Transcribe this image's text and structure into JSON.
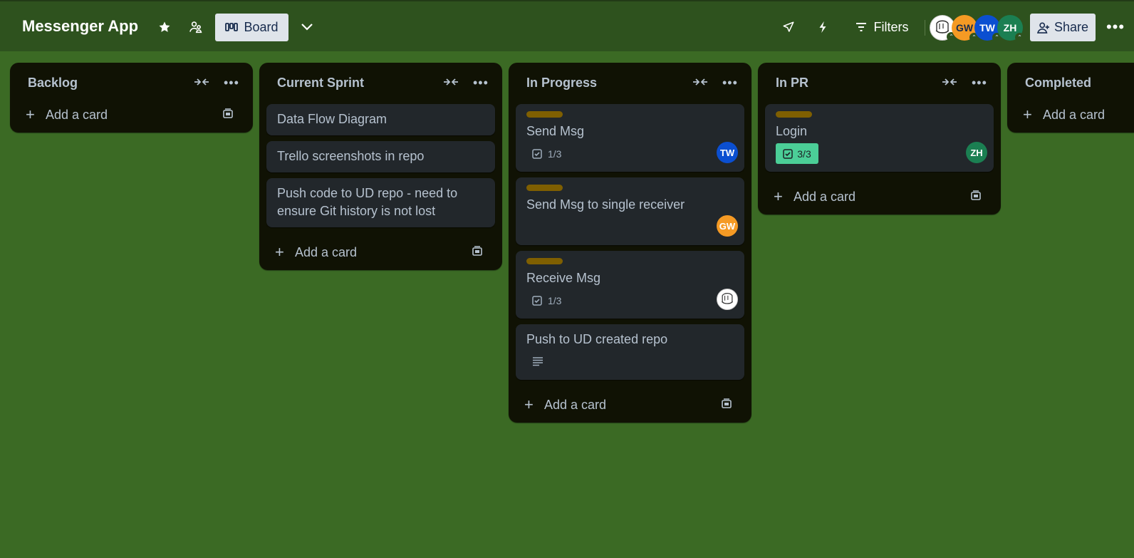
{
  "header": {
    "board_title": "Messenger App",
    "view_label": "Board",
    "filters_label": "Filters",
    "share_label": "Share",
    "members": [
      {
        "initials": "",
        "color": "#ffffff",
        "type": "sketch-avatar"
      },
      {
        "initials": "GW",
        "color": "#f59a24"
      },
      {
        "initials": "TW",
        "color": "#0b4fd1"
      },
      {
        "initials": "ZH",
        "color": "#1b7f52"
      }
    ]
  },
  "lists": [
    {
      "title": "Backlog",
      "add_label": "Add a card",
      "cards": []
    },
    {
      "title": "Current Sprint",
      "add_label": "Add a card",
      "cards": [
        {
          "title": "Data Flow Diagram"
        },
        {
          "title": "Trello screenshots in repo"
        },
        {
          "title": "Push code to UD repo - need to ensure Git history is not lost"
        }
      ]
    },
    {
      "title": "In Progress",
      "add_label": "Add a card",
      "cards": [
        {
          "title": "Send Msg",
          "checklist": "1/3",
          "member": "TW",
          "member_color": "#0b4fd1"
        },
        {
          "title": "Send Msg to single receiver",
          "member": "GW",
          "member_color": "#f59a24"
        },
        {
          "title": "Receive Msg",
          "checklist": "1/3",
          "member": "",
          "member_color": "#ffffff"
        },
        {
          "title": "Push to UD created repo",
          "has_description": true
        }
      ]
    },
    {
      "title": "In PR",
      "add_label": "Add a card",
      "cards": [
        {
          "title": "Login",
          "checklist": "3/3",
          "checklist_complete": true,
          "member": "ZH",
          "member_color": "#1b7f52"
        }
      ]
    },
    {
      "title": "Completed",
      "add_label": "Add a card",
      "cards": []
    }
  ],
  "colors": {
    "background": "#3b6a24",
    "header": "#2e521e",
    "list": "#101204",
    "card": "#22272b",
    "label": "#7f5f01",
    "complete_badge": "#4bce97"
  }
}
